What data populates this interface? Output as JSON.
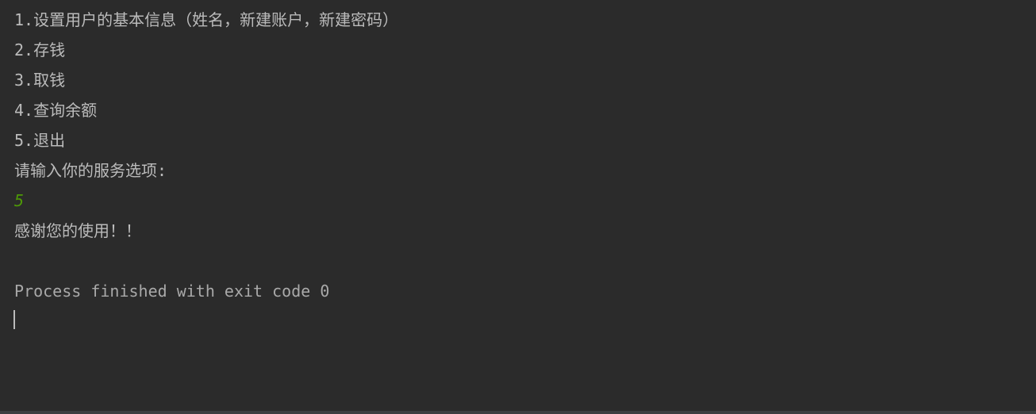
{
  "menu": {
    "item1": "1.设置用户的基本信息（姓名，新建账户，新建密码）",
    "item2": "2.存钱",
    "item3": "3.取钱",
    "item4": "4.查询余额",
    "item5": "5.退出"
  },
  "prompt": "请输入你的服务选项:",
  "user_input": "5",
  "farewell": "感谢您的使用！！",
  "exit_message": "Process finished with exit code 0"
}
